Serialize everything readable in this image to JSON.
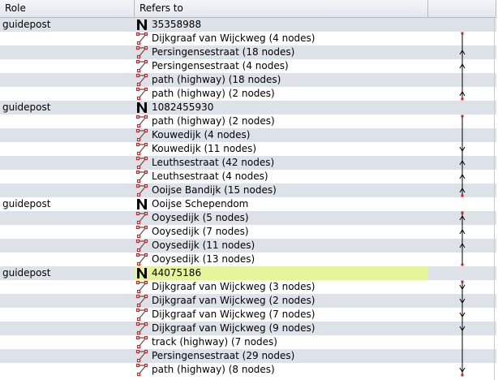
{
  "header": {
    "role": "Role",
    "refers_to": "Refers to"
  },
  "colors": {
    "highlight": "#e6f59b",
    "alt_row": "#dde1e8",
    "way_icon": "#cc2222"
  },
  "rows": [
    {
      "role": "guidepost",
      "text": "35358988",
      "icon": "node-icon",
      "link": "none"
    },
    {
      "role": "",
      "text": "Dijkgraaf van Wijckweg (4 nodes)",
      "icon": "way-icon",
      "link": "start"
    },
    {
      "role": "",
      "text": "Persingensestraat (18 nodes)",
      "icon": "way-icon",
      "link": "mid-up"
    },
    {
      "role": "",
      "text": "Persingensestraat (4 nodes)",
      "icon": "way-icon",
      "link": "mid-up"
    },
    {
      "role": "",
      "text": "path (highway) (18 nodes)",
      "icon": "way-icon",
      "link": "mid"
    },
    {
      "role": "",
      "text": "path (highway) (2 nodes)",
      "icon": "way-icon",
      "link": "end-up"
    },
    {
      "role": "guidepost",
      "text": "1082455930",
      "icon": "node-icon",
      "link": "none"
    },
    {
      "role": "",
      "text": "path (highway) (2 nodes)",
      "icon": "way-icon",
      "link": "start"
    },
    {
      "role": "",
      "text": "Kouwedijk (4 nodes)",
      "icon": "way-icon",
      "link": "mid"
    },
    {
      "role": "",
      "text": "Kouwedijk (11 nodes)",
      "icon": "way-icon",
      "link": "mid-down"
    },
    {
      "role": "",
      "text": "Leuthsestraat (42 nodes)",
      "icon": "way-icon",
      "link": "mid-up"
    },
    {
      "role": "",
      "text": "Leuthsestraat (4 nodes)",
      "icon": "way-icon",
      "link": "mid-up"
    },
    {
      "role": "",
      "text": "Ooijse Bandijk (15 nodes)",
      "icon": "way-icon",
      "link": "end-up"
    },
    {
      "role": "guidepost",
      "text": "Ooijse Schependom",
      "icon": "node-icon",
      "link": "none"
    },
    {
      "role": "",
      "text": "Ooysedijk (5 nodes)",
      "icon": "way-icon",
      "link": "start-up"
    },
    {
      "role": "",
      "text": "Ooysedijk (7 nodes)",
      "icon": "way-icon",
      "link": "mid-up"
    },
    {
      "role": "",
      "text": "Ooysedijk (11 nodes)",
      "icon": "way-icon",
      "link": "mid-up"
    },
    {
      "role": "",
      "text": "Ooysedijk (13 nodes)",
      "icon": "way-icon",
      "link": "end"
    },
    {
      "role": "guidepost",
      "text": "44075186",
      "icon": "node-icon",
      "link": "none",
      "highlight": true
    },
    {
      "role": "",
      "text": "Dijkgraaf van Wijckweg (3 nodes)",
      "icon": "way-icon",
      "link": "start-down"
    },
    {
      "role": "",
      "text": "Dijkgraaf van Wijckweg (2 nodes)",
      "icon": "way-icon",
      "link": "mid-down"
    },
    {
      "role": "",
      "text": "Dijkgraaf van Wijckweg (7 nodes)",
      "icon": "way-icon",
      "link": "mid-down"
    },
    {
      "role": "",
      "text": "Dijkgraaf van Wijckweg (9 nodes)",
      "icon": "way-icon",
      "link": "mid-down"
    },
    {
      "role": "",
      "text": "track (highway) (7 nodes)",
      "icon": "way-icon",
      "link": "mid"
    },
    {
      "role": "",
      "text": "Persingensestraat (29 nodes)",
      "icon": "way-icon",
      "link": "mid"
    },
    {
      "role": "",
      "text": "path (highway) (8 nodes)",
      "icon": "way-icon",
      "link": "end-down"
    }
  ]
}
